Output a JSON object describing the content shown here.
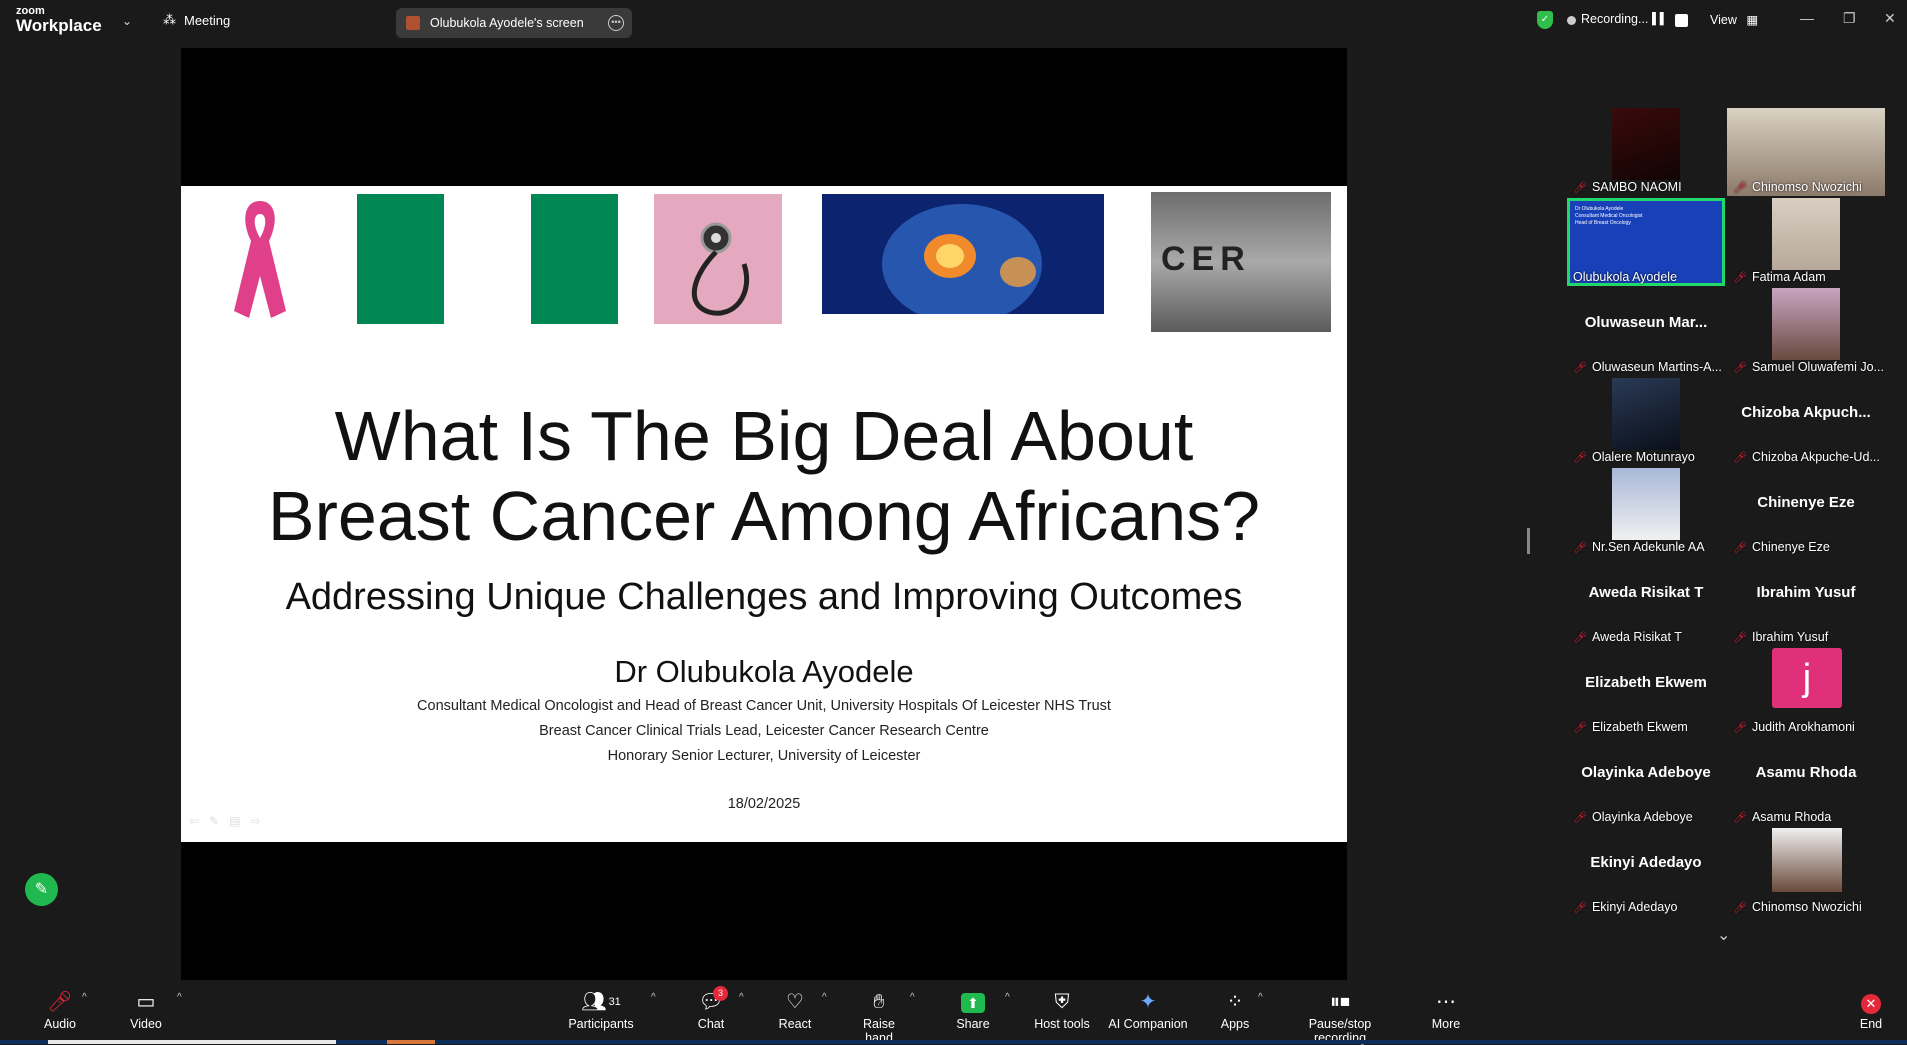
{
  "app": {
    "logo_small": "zoom",
    "logo_big": "Workplace",
    "meeting_label": "Meeting",
    "screen_share_label": "Olubukola Ayodele's screen",
    "recording_label": "Recording...",
    "view_label": "View"
  },
  "slide": {
    "title_line1": "What Is The Big Deal About",
    "title_line2": "Breast Cancer Among Africans?",
    "subtitle": "Addressing Unique Challenges and Improving Outcomes",
    "author": "Dr Olubukola Ayodele",
    "line1": "Consultant Medical Oncologist and Head of Breast Cancer Unit, University Hospitals Of Leicester NHS Trust",
    "line2": "Breast Cancer Clinical Trials Lead, Leicester Cancer Research Centre",
    "line3": "Honorary Senior Lecturer, University of Leicester",
    "date": "18/02/2025",
    "letter_cube_text": "CER"
  },
  "participants": [
    {
      "label": "SAMBO NAOMI",
      "big": ""
    },
    {
      "label": "Chinomso Nwozichi",
      "big": ""
    },
    {
      "label": "Olubukola Ayodele",
      "big": ""
    },
    {
      "label": "Fatima Adam",
      "big": ""
    },
    {
      "label": "Oluwaseun Martins-A...",
      "big": "Oluwaseun  Mar..."
    },
    {
      "label": "Samuel Oluwafemi Jo...",
      "big": ""
    },
    {
      "label": "Olalere Motunrayo",
      "big": ""
    },
    {
      "label": "Chizoba Akpuche-Ud...",
      "big": "Chizoba  Akpuch..."
    },
    {
      "label": "Nr.Sen Adekunle AA",
      "big": ""
    },
    {
      "label": "Chinenye Eze",
      "big": "Chinenye Eze"
    },
    {
      "label": "Aweda Risikat T",
      "big": "Aweda Risikat T"
    },
    {
      "label": "Ibrahim Yusuf",
      "big": "Ibrahim Yusuf"
    },
    {
      "label": "Elizabeth Ekwem",
      "big": "Elizabeth Ekwem"
    },
    {
      "label": "Judith Arokhamoni",
      "big": "",
      "avatar_letter": "j"
    },
    {
      "label": "Olayinka Adeboye",
      "big": "Olayinka Adeboye"
    },
    {
      "label": "Asamu Rhoda",
      "big": "Asamu Rhoda"
    },
    {
      "label": "Ekinyi Adedayo",
      "big": "Ekinyi Adedayo"
    },
    {
      "label": "Chinomso Nwozichi",
      "big": ""
    }
  ],
  "share_thumb": {
    "line1": "Dr Olubukola Ayodele",
    "line2": "Consultant Medical Oncologist",
    "line3": "Head of Breast Oncology"
  },
  "toolbar": {
    "audio": "Audio",
    "video": "Video",
    "participants": "Participants",
    "participants_count": "31",
    "chat": "Chat",
    "chat_badge": "3",
    "react": "React",
    "raise_hand": "Raise hand",
    "share": "Share",
    "host_tools": "Host tools",
    "ai_companion": "AI Companion",
    "apps": "Apps",
    "pause_stop": "Pause/stop recording",
    "more": "More",
    "end": "End"
  },
  "colors": {
    "nigeria_green": "#008753",
    "share_green": "#20b94f",
    "end_red": "#e5283a",
    "active_speaker": "#23d86a"
  }
}
